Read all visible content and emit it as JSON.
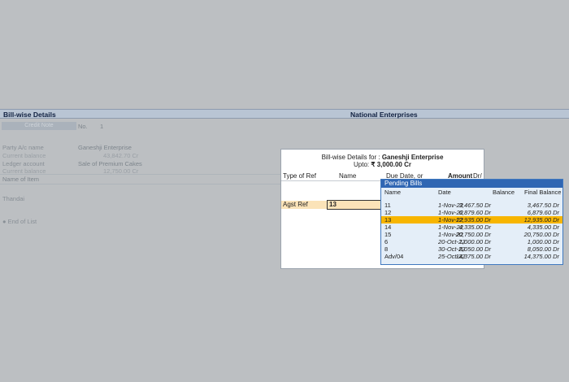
{
  "header": {
    "left_title": "Bill-wise Details",
    "center_title": "National Enterprises"
  },
  "voucher": {
    "type_label": "Credit Note",
    "no_label": "No.",
    "no_value": "1",
    "party_label": "Party A/c name",
    "party_value": "Ganeshji Enterprise",
    "current_balance_label": "Current balance",
    "current_balance_value": "43,842.70 Cr",
    "ledger_label": "Ledger account",
    "ledger_value": "Sale of Premium Cakes",
    "ledger_balance_label": "Current balance",
    "ledger_balance_value": "12,750.00 Cr",
    "name_of_item_label": "Name of Item",
    "item_value": "Thandai",
    "end_of_list": "● End of List"
  },
  "dialog": {
    "heading_label": "Bill-wise Details for :",
    "heading_party": "Ganeshji Enterprise",
    "upto_label": "Upto:",
    "upto_value": "₹ 3,000.00 Cr",
    "col_type_of_ref": "Type of Ref",
    "col_name": "Name",
    "col_due_date": "Due Date, or",
    "col_amount": "Amount",
    "col_drcr": "Dr/",
    "ref_type_value": "Agst Ref",
    "name_value": "13"
  },
  "pending_bills": {
    "title": "Pending Bills",
    "col_name": "Name",
    "col_date": "Date",
    "col_balance": "Balance",
    "col_final_balance": "Final Balance",
    "selected_index": 2,
    "rows": [
      {
        "name": "11",
        "date": "1-Nov-22",
        "balance": "3,467.50 Dr",
        "final": "3,467.50 Dr"
      },
      {
        "name": "12",
        "date": "1-Nov-22",
        "balance": "6,879.60 Dr",
        "final": "6,879.60 Dr"
      },
      {
        "name": "13",
        "date": "1-Nov-22",
        "balance": "12,935.00 Dr",
        "final": "12,935.00 Dr"
      },
      {
        "name": "14",
        "date": "1-Nov-22",
        "balance": "4,335.00 Dr",
        "final": "4,335.00 Dr"
      },
      {
        "name": "15",
        "date": "1-Nov-22",
        "balance": "20,750.00 Dr",
        "final": "20,750.00 Dr"
      },
      {
        "name": "6",
        "date": "20-Oct-22",
        "balance": "1,000.00 Dr",
        "final": "1,000.00 Dr"
      },
      {
        "name": "8",
        "date": "30-Oct-22",
        "balance": "8,050.00 Dr",
        "final": "8,050.00 Dr"
      },
      {
        "name": "Adv/04",
        "date": "25-Oct-22",
        "balance": "14,375.00 Dr",
        "final": "14,375.00 Dr"
      }
    ]
  },
  "colors": {
    "background": "#bcbfc2",
    "header_bar": "#b9c5d4",
    "popup_title": "#2f66b3",
    "selection": "#f7b500",
    "input_highlight": "#fbe3b8"
  }
}
